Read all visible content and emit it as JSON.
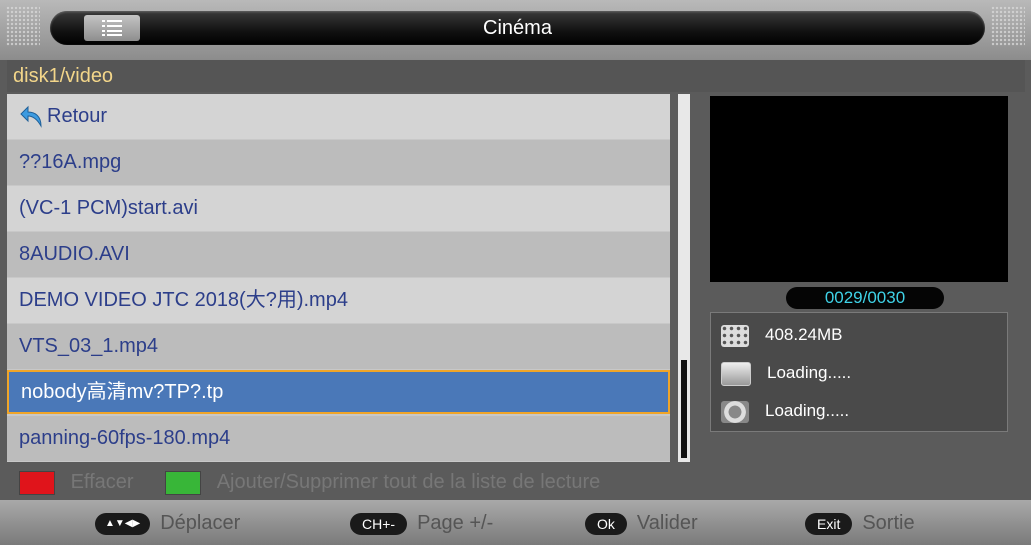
{
  "header": {
    "title": "Cinéma",
    "menu_icon": "list-icon"
  },
  "path": "disk1/video",
  "files": [
    {
      "label": "Retour",
      "icon": "back-arrow-icon"
    },
    {
      "label": "??16A.mpg"
    },
    {
      "label": "(VC-1 PCM)start.avi"
    },
    {
      "label": "8AUDIO.AVI"
    },
    {
      "label": "DEMO VIDEO JTC 2018(大?用).mp4"
    },
    {
      "label": "VTS_03_1.mp4"
    },
    {
      "label": "nobody高清mv?TP?.tp",
      "selected": true
    },
    {
      "label": "panning-60fps-180.mp4"
    }
  ],
  "scroll": {
    "position_fraction": 0.74
  },
  "counter": "0029/0030",
  "info": {
    "size": "408.24MB",
    "resolution": "Loading.....",
    "codec": "Loading....."
  },
  "legend": {
    "red_label": "Effacer",
    "green_label": "Ajouter/Supprimer tout de la liste de lecture",
    "red_color": "#e0141b",
    "green_color": "#38b638"
  },
  "footer": {
    "move_key": "▲▼◀▶",
    "move_label": "Déplacer",
    "page_key": "CH+-",
    "page_label": "Page +/-",
    "ok_key": "Ok",
    "ok_label": "Valider",
    "exit_key": "Exit",
    "exit_label": "Sortie"
  },
  "colors": {
    "list_text": "#2c3e8a",
    "selected_bg": "#4a78b8",
    "selected_border": "#f0a528",
    "path_text": "#f3d68a",
    "counter_text": "#3fd3e8"
  }
}
